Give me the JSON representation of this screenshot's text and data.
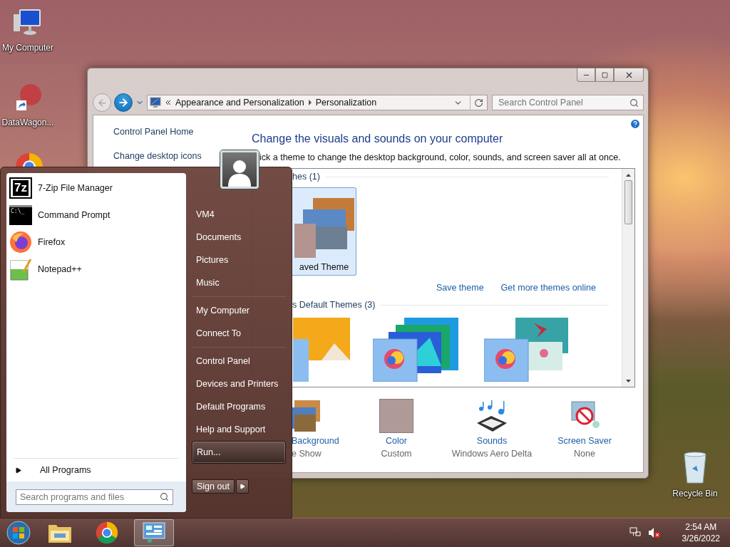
{
  "desktop_icons": [
    {
      "kind": "computer",
      "label": "My Computer"
    },
    {
      "kind": "shortcut",
      "label": "DataWagon..."
    },
    {
      "kind": "chrome"
    },
    {
      "kind": "recycle",
      "label": "Recycle Bin"
    }
  ],
  "window": {
    "address": [
      "Appearance and Personalization",
      "Personalization"
    ],
    "search_placeholder": "Search Control Panel",
    "nav": [
      "Control Panel Home",
      "Change desktop icons"
    ],
    "heading": "Change the visuals and sounds on your computer",
    "description": "ick a theme to change the desktop background, color, sounds, and screen saver all at once.",
    "sections": [
      {
        "title": "hes (1)",
        "themes": [
          {
            "kind": "landscape",
            "label": "aved Theme",
            "selected": true
          }
        ],
        "links": [
          "Save theme",
          "Get more themes online"
        ]
      },
      {
        "title": "s Default Themes (3)",
        "themes": [
          {
            "kind": "orange",
            "selected": false
          },
          {
            "kind": "blue",
            "selected": false
          },
          {
            "kind": "flower",
            "selected": false
          }
        ]
      }
    ],
    "settings": [
      {
        "kind": "background",
        "title": "Background",
        "value": "e Show"
      },
      {
        "kind": "color",
        "title": "Color",
        "value": "Custom",
        "color": "#b09a98"
      },
      {
        "kind": "sounds",
        "title": "Sounds",
        "value": "Windows Aero Delta"
      },
      {
        "kind": "screensaver",
        "title": "Screen Saver",
        "value": "None"
      }
    ]
  },
  "start_menu": {
    "programs": [
      {
        "kind": "archiver",
        "label": "7-Zip File Manager",
        "icon_text": "7z"
      },
      {
        "kind": "cmd",
        "label": "Command Prompt",
        "icon_text": "C:\\_"
      },
      {
        "kind": "firefox",
        "label": "Firefox"
      },
      {
        "kind": "notepad",
        "label": "Notepad++"
      }
    ],
    "all_programs": "All Programs",
    "search_placeholder": "Search programs and files",
    "places": [
      [
        {
          "label": "VM4",
          "selected": false
        },
        {
          "label": "Documents",
          "selected": false
        },
        {
          "label": "Pictures",
          "selected": false
        },
        {
          "label": "Music",
          "selected": false
        }
      ],
      [
        {
          "label": "My Computer",
          "selected": false
        },
        {
          "label": "Connect To",
          "selected": false
        }
      ],
      [
        {
          "label": "Control Panel",
          "selected": false
        },
        {
          "label": "Devices and Printers",
          "selected": false
        },
        {
          "label": "Default Programs",
          "selected": false
        },
        {
          "label": "Help and Support",
          "selected": false
        },
        {
          "label": "Run...",
          "selected": true
        }
      ]
    ],
    "sign_out": "Sign out"
  },
  "taskbar": {
    "apps": [
      {
        "kind": "explorer",
        "selected": false
      },
      {
        "kind": "chrome",
        "selected": false
      },
      {
        "kind": "control-panel",
        "selected": true
      }
    ],
    "time": "2:54 AM",
    "date": "3/26/2022"
  }
}
